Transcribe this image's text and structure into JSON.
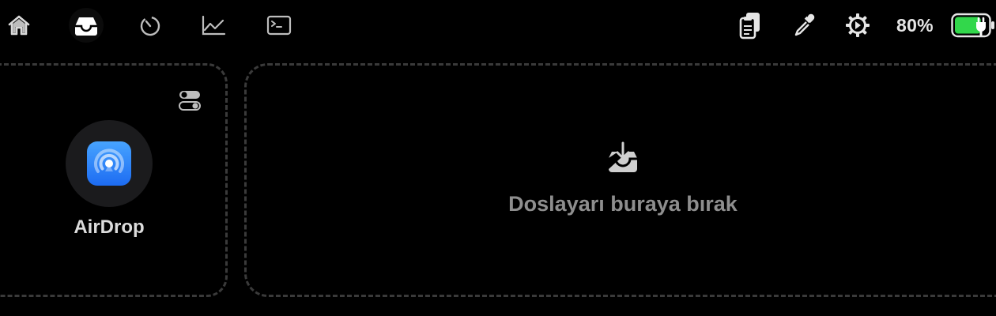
{
  "topbar": {
    "nav": [
      {
        "id": "home",
        "icon": "house-icon"
      },
      {
        "id": "tray",
        "icon": "tray-icon",
        "active": true
      },
      {
        "id": "timer",
        "icon": "timer-icon"
      },
      {
        "id": "stats",
        "icon": "chart-icon"
      },
      {
        "id": "terminal",
        "icon": "terminal-icon"
      }
    ],
    "right_icons": [
      "clipboard-icon",
      "eyedropper-icon",
      "gear-icon"
    ],
    "battery_percent": "80%",
    "battery_level": 0.8,
    "battery_charging": true
  },
  "shelf": {
    "airdrop_label": "AirDrop",
    "drop_text": "Doslayarı buraya bırak"
  },
  "colors": {
    "background": "#000000",
    "dash_border": "#3a3a3a",
    "icon": "#d9d9d9",
    "battery_fill": "#32d74b",
    "airdrop_blue": "#2f86f6"
  }
}
